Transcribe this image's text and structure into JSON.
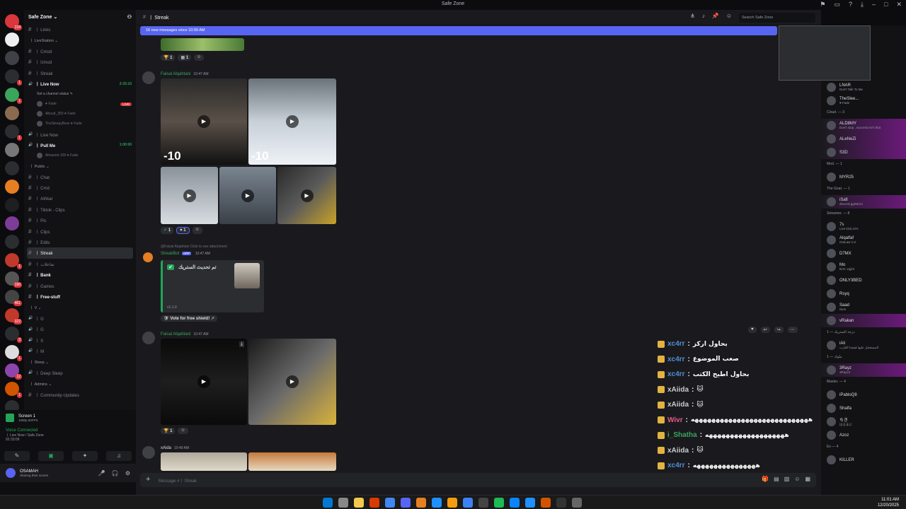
{
  "window": {
    "title": "Safe Zone"
  },
  "guilds": [
    {
      "color": "#da373c",
      "badge": "234"
    },
    {
      "color": "#eeeeee",
      "badge": ""
    },
    {
      "color": "#3f4147",
      "badge": ""
    },
    {
      "color": "#2b2d31",
      "badge": "1"
    },
    {
      "color": "#3ba55d",
      "badge": "1"
    },
    {
      "color": "#8a6b4f",
      "badge": ""
    },
    {
      "color": "#2b2d31",
      "badge": "1"
    },
    {
      "color": "#777777",
      "badge": ""
    },
    {
      "color": "#2b2d31",
      "badge": ""
    },
    {
      "color": "#e67e22",
      "badge": ""
    },
    {
      "color": "#1e1f22",
      "badge": ""
    },
    {
      "color": "#7d3c98",
      "badge": ""
    },
    {
      "color": "#2b2d31",
      "badge": ""
    },
    {
      "color": "#c0392b",
      "badge": "1"
    },
    {
      "color": "#555555",
      "badge": "190"
    },
    {
      "color": "#444444",
      "badge": "461"
    },
    {
      "color": "#c0392b",
      "badge": "322"
    },
    {
      "color": "#2b2d31",
      "badge": "3"
    },
    {
      "color": "#dddddd",
      "badge": "1"
    },
    {
      "color": "#8e44ad",
      "badge": "12"
    },
    {
      "color": "#d35400",
      "badge": "1"
    },
    {
      "color": "#2b2d31",
      "badge": "16"
    },
    {
      "color": "#2b2d31",
      "badge": "1"
    }
  ],
  "server": {
    "name": "Safe Zone ⌄"
  },
  "channel_list": [
    {
      "kind": "channel",
      "label": "ㅣ Links"
    },
    {
      "kind": "category",
      "label": "ㅣ LiveStation ⌄"
    },
    {
      "kind": "channel",
      "label": "ㅣ Cmod"
    },
    {
      "kind": "channel",
      "label": "ㅣ Umod"
    },
    {
      "kind": "channel",
      "label": "ㅣ Streak"
    },
    {
      "kind": "voice-live",
      "label": "ㅣ Live Now",
      "time": "2:33:10"
    },
    {
      "kind": "status",
      "label": "Set a channel status ✎"
    },
    {
      "kind": "voice-user",
      "label": "♥ Fade",
      "live": "LIVE"
    },
    {
      "kind": "voice-user",
      "label": "Aboud_350 ♥ Fade"
    },
    {
      "kind": "voice-user",
      "label": "TheSleepyBear ♥ Fade"
    },
    {
      "kind": "voice",
      "label": "ㅣ Live Now"
    },
    {
      "kind": "voice-live",
      "label": "ㅣ Pull Me",
      "time": "1:00:00"
    },
    {
      "kind": "voice-user",
      "label": "Almazmi-109 ♥ Fade"
    },
    {
      "kind": "category",
      "label": "ㅣ Public ⌄"
    },
    {
      "kind": "channel",
      "label": "ㅣ Chat"
    },
    {
      "kind": "channel",
      "label": "ㅣ Cmd"
    },
    {
      "kind": "channel",
      "label": "ㅣ Athkar"
    },
    {
      "kind": "channel",
      "label": "ㅣ Tiktok - Clips"
    },
    {
      "kind": "channel",
      "label": "ㅣ Pic"
    },
    {
      "kind": "channel",
      "label": "ㅣ Clips"
    },
    {
      "kind": "channel",
      "label": "ㅣ Edits"
    },
    {
      "kind": "active",
      "label": "ㅣ Streak"
    },
    {
      "kind": "channel",
      "label": "ㅣ تفاعلات"
    },
    {
      "kind": "bright",
      "label": "ㅣ Bank"
    },
    {
      "kind": "channel",
      "label": "ㅣ Games"
    },
    {
      "kind": "bright",
      "label": "ㅣ Free-stuff"
    },
    {
      "kind": "category",
      "label": "ㅣ V ⌄"
    },
    {
      "kind": "voice",
      "label": "ㅣ G"
    },
    {
      "kind": "voice",
      "label": "ㅣ G"
    },
    {
      "kind": "voice",
      "label": "ㅣ S"
    },
    {
      "kind": "voice",
      "label": "ㅣ M"
    },
    {
      "kind": "category",
      "label": "ㅣ Sleep ⌄"
    },
    {
      "kind": "voice",
      "label": "ㅣ Deep Sleep"
    },
    {
      "kind": "category",
      "label": "ㅣ Admins ⌄"
    },
    {
      "kind": "channel",
      "label": "ㅣ Community-Updates"
    }
  ],
  "user_panel": {
    "screen_title": "Screen 1",
    "screen_sub": "1080p 60FPS",
    "voice_status": "Voice Connected",
    "voice_channel": "ㅣ Live Now / Safe Zone",
    "voice_time": "02:33:09",
    "username": "OSAMAH",
    "user_status": "Sharing their screen"
  },
  "header": {
    "channel": "ㅣ Streak",
    "search_placeholder": "Search Safe Zone",
    "new_messages": "16 new messages since 10:09 AM"
  },
  "messages": {
    "m1_author": "Faisal Alqahtani",
    "m1_time": "10:47 AM",
    "m1_temp1": "-10",
    "m1_temp2": "-10",
    "m1_react1": "1",
    "m1_react2": "1",
    "m0_react1": "1",
    "m0_react2": "1",
    "bot_reply": "@Faisal Alqahtani  Click to see attachment",
    "bot_name": "StreakBot",
    "bot_tag": "APP",
    "bot_time": "10:47 AM",
    "embed_title": "تم تحديث الستريك",
    "embed_footer": "v1.1.0",
    "vote_button": "Vote for free shield!",
    "m2_author": "Faisal Alqahtani",
    "m2_time": "10:47 AM",
    "m2_react": "1",
    "m3_author": "xAida",
    "m3_time": "10:49 AM"
  },
  "stream_chat": [
    {
      "name": "xc4rr",
      "text": "بحاول اركز"
    },
    {
      "name": "xc4rr",
      "text": "صعب الموضوع"
    },
    {
      "name": "xc4rr",
      "text": "بحاول اطيح الكتب"
    },
    {
      "name": "xAiida",
      "text": "🐱"
    },
    {
      "name": "xAiida",
      "text": "🐱"
    },
    {
      "name": "Wivr",
      "text": "ههههههههههههههههههههههههههههه"
    },
    {
      "name": "i_Shatha",
      "text": "هههههههههههههههههههه"
    },
    {
      "name": "xAiida",
      "text": "🐱"
    },
    {
      "name": "xc4rr",
      "text": "هههههههههههههههه"
    }
  ],
  "composer": {
    "placeholder": "Message #ㅣ Streak"
  },
  "members": [
    {
      "kind": "member",
      "name": "LNAR",
      "status": "Don't Talk To Me"
    },
    {
      "kind": "member",
      "name": "TheSlee...",
      "status": "♥ Fade"
    },
    {
      "kind": "category",
      "name": "Cloud. — 3"
    },
    {
      "kind": "member-hl",
      "name": "ALD8MY",
      "status": "Don't stop , success isn't that"
    },
    {
      "kind": "member-hl",
      "name": "ALeNeZi",
      "status": ""
    },
    {
      "kind": "member-hl",
      "name": "S3D",
      "status": ""
    },
    {
      "kind": "category",
      "name": "Mod. — 1"
    },
    {
      "kind": "member",
      "name": "MYR25",
      "status": ""
    },
    {
      "kind": "category",
      "name": "The Goat. — 1"
    },
    {
      "kind": "member-hl",
      "name": "iSafi",
      "status": "discord.gg/WUU"
    },
    {
      "kind": "category",
      "name": "Streamer. — 8"
    },
    {
      "kind": "member",
      "name": "7s",
      "status": "Live kick.si7s"
    },
    {
      "kind": "member",
      "name": "Alqalfaf",
      "status": "OutLaw V.2"
    },
    {
      "kind": "member",
      "name": "D7MX",
      "status": ""
    },
    {
      "kind": "member",
      "name": "Mo",
      "status": "kick: vqj23"
    },
    {
      "kind": "member",
      "name": "ONLY3BED",
      "status": ""
    },
    {
      "kind": "member",
      "name": "Rsyq",
      "status": ""
    },
    {
      "kind": "member",
      "name": "Saad",
      "status": "Nvm"
    },
    {
      "kind": "member-hl",
      "name": "vRakan",
      "status": ""
    },
    {
      "kind": "category",
      "name": "درجة الستريك — 1"
    },
    {
      "kind": "member",
      "name": "iAli",
      "status": "المستعجل عليها فيتعدا القارب"
    },
    {
      "kind": "category",
      "name": "ملوك — 1"
    },
    {
      "kind": "member-hl",
      "name": "3Rayz",
      "status": "3Rayz2"
    },
    {
      "kind": "category",
      "name": "Master. — 4"
    },
    {
      "kind": "member",
      "name": "iPabloQ8",
      "status": ""
    },
    {
      "kind": "member",
      "name": "Shalfa",
      "status": ""
    },
    {
      "kind": "member",
      "name": "ちき",
      "status": "はるまに"
    },
    {
      "kind": "member",
      "name": "Azoz",
      "status": ""
    },
    {
      "kind": "category",
      "name": "Ex — 4"
    },
    {
      "kind": "member",
      "name": "KILLER",
      "status": ""
    }
  ],
  "taskbar": {
    "time": "11:01 AM",
    "date": "12/20/2025",
    "apps": [
      "#0078d4",
      "#888888",
      "#f2c94c",
      "#d83b01",
      "#4285f4",
      "#5865f2",
      "#e67e22",
      "#1e90ff",
      "#f39c12",
      "#3b82f6",
      "#444444",
      "#1db954",
      "#0a84ff",
      "#1e90ff",
      "#d35400",
      "#333333",
      "#666666"
    ]
  }
}
